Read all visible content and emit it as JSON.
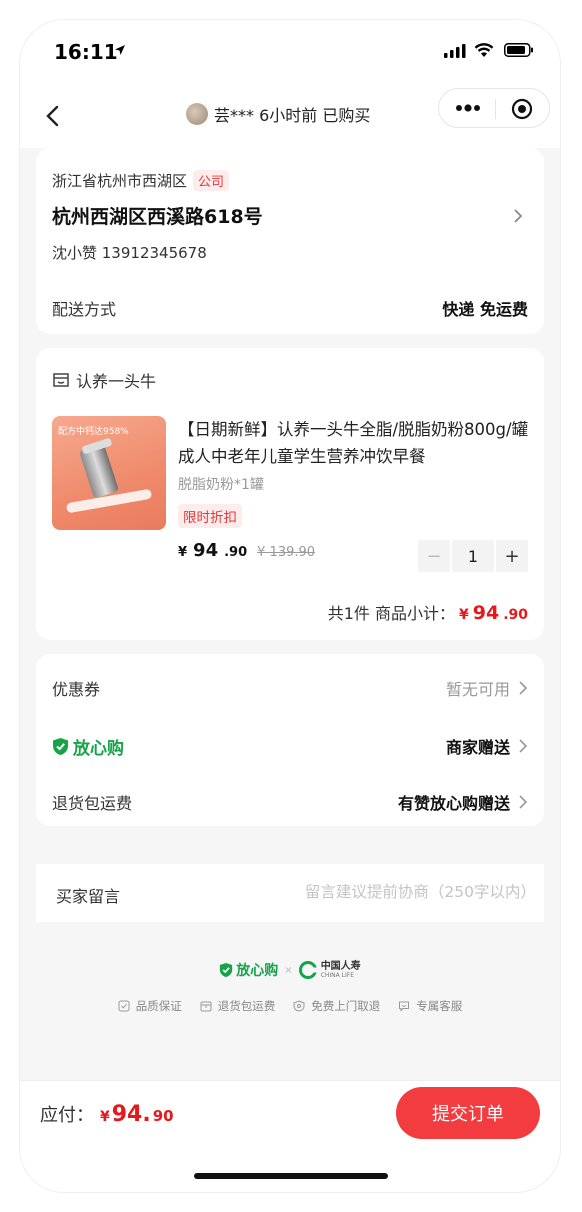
{
  "status_bar": {
    "time": "16:11"
  },
  "nav": {
    "title": "芸*** 6小时前 已购买"
  },
  "address": {
    "region": "浙江省杭州市西湖区",
    "tag": "公司",
    "street": "杭州西湖区西溪路618号",
    "contact": "沈小赞 13912345678",
    "shipping_label": "配送方式",
    "shipping_value": "快递 免运费"
  },
  "product": {
    "store": "认养一头牛",
    "thumb_text": "配方中钙达958%",
    "title": "【日期新鲜】认养一头牛全脂/脱脂奶粉800g/罐成人中老年儿童学生营养冲饮早餐",
    "spec": "脱脂奶粉*1罐",
    "discount_tag": "限时折扣",
    "price_symbol": "¥",
    "price_int": "94",
    "price_dec": ".90",
    "original_price": "¥ 139.90",
    "quantity": "1",
    "subtotal_prefix": "共1件  商品小计：",
    "subtotal_symbol": "¥",
    "subtotal_int": "94",
    "subtotal_dec": ".90"
  },
  "options": {
    "coupon_label": "优惠券",
    "coupon_value": "暂无可用",
    "assurance_label": "放心购",
    "assurance_value": "商家赠送",
    "return_label": "退货包运费",
    "return_value": "有赞放心购赠送"
  },
  "message": {
    "label": "买家留言",
    "placeholder": "留言建议提前协商（250字以内）"
  },
  "guarantee": {
    "brand": "放心购",
    "partner_cn": "中国人寿",
    "partner_en": "CHINA LIFE",
    "features": [
      "品质保证",
      "退货包运费",
      "免费上门取退",
      "专属客服"
    ]
  },
  "footer": {
    "pay_label": "应付：",
    "pay_symbol": "¥",
    "pay_int": "94.",
    "pay_dec": "90",
    "submit_label": "提交订单"
  },
  "colors": {
    "accent_red": "#f23c3f",
    "price_red": "#e5191c",
    "assurance_green": "#16a34a"
  }
}
